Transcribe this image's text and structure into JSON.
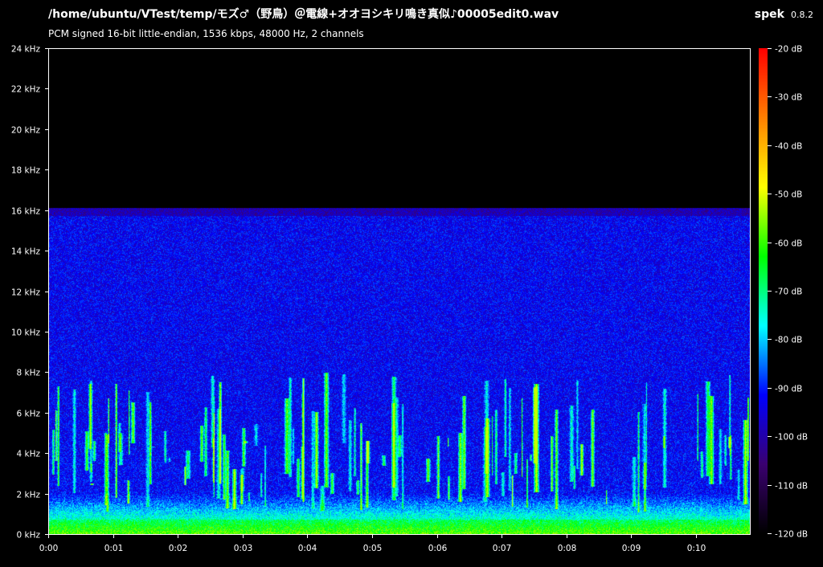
{
  "header": {
    "title": "/home/ubuntu/VTest/temp/モズ♂（野鳥）＠電線+オオヨシキリ鳴き真似♪00005edit0.wav",
    "subtitle": "PCM signed 16-bit little-endian, 1536 kbps, 48000 Hz, 2 channels",
    "app_name": "spek",
    "app_version": "0.8.2"
  },
  "chart_data": {
    "type": "heatmap",
    "title": "",
    "xlabel": "",
    "ylabel": "",
    "x_ticks": [
      "0:00",
      "0:01",
      "0:02",
      "0:03",
      "0:04",
      "0:05",
      "0:06",
      "0:07",
      "0:08",
      "0:09",
      "0:10"
    ],
    "x_tick_values": [
      0,
      60,
      120,
      180,
      240,
      300,
      360,
      420,
      480,
      540,
      600
    ],
    "xlim": [
      0,
      650
    ],
    "y_ticks": [
      "0 kHz",
      "2 kHz",
      "4 kHz",
      "6 kHz",
      "8 kHz",
      "10 kHz",
      "12 kHz",
      "14 kHz",
      "16 kHz",
      "18 kHz",
      "20 kHz",
      "22 kHz",
      "24 kHz"
    ],
    "y_tick_values": [
      0,
      2,
      4,
      6,
      8,
      10,
      12,
      14,
      16,
      18,
      20,
      22,
      24
    ],
    "ylim": [
      0,
      24
    ],
    "content_cutoff_khz": 16,
    "colorbar": {
      "ticks": [
        "-20 dB",
        "-30 dB",
        "-40 dB",
        "-50 dB",
        "-60 dB",
        "-70 dB",
        "-80 dB",
        "-90 dB",
        "-100 dB",
        "-110 dB",
        "-120 dB"
      ],
      "tick_values": [
        -20,
        -30,
        -40,
        -50,
        -60,
        -70,
        -80,
        -90,
        -100,
        -110,
        -120
      ],
      "range": [
        -120,
        -20
      ]
    },
    "colors": {
      "colormap": [
        "#000000",
        "#3a0070",
        "#0000ff",
        "#00ffff",
        "#00ff00",
        "#ffff00",
        "#ff8000",
        "#ff0000"
      ],
      "background": "#000000",
      "axis": "#ffffff"
    }
  }
}
